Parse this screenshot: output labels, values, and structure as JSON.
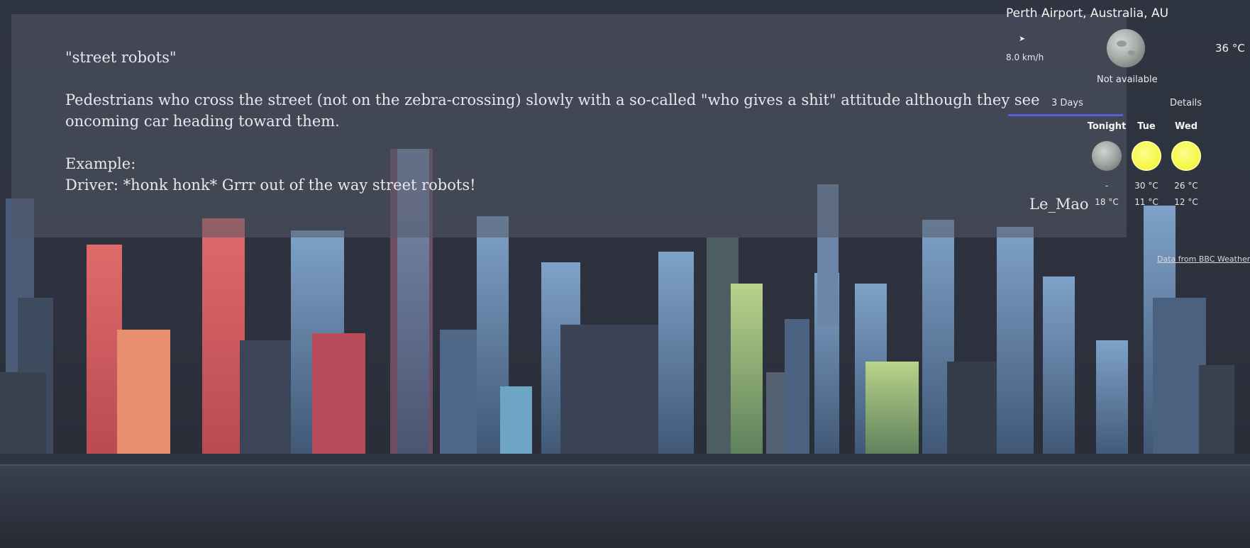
{
  "note": {
    "text": "\"street robots\"\n\nPedestrians who cross the street (not on the zebra-crossing) slowly with a so-called \"who gives a shit\" attitude although they see oncoming car heading toward them.\n\nExample:\nDriver: *honk honk* Grrr out of the way street robots!",
    "author": "Le_Mao"
  },
  "weather": {
    "location": "Perth Airport, Australia, AU",
    "wind_icon": "wind-arrow-icon",
    "wind_speed": "8.0 km/h",
    "current_icon": "night-moon-icon",
    "current_condition": "Not available",
    "current_temp": "36 °C",
    "tabs": [
      "3 Days",
      "Details"
    ],
    "accent": "#5a5fd8",
    "forecast": [
      {
        "day": "Tonight",
        "icon": "moon-icon",
        "high": "-",
        "low": "18 °C"
      },
      {
        "day": "Tue",
        "icon": "sun-icon",
        "high": "30 °C",
        "low": "11 °C"
      },
      {
        "day": "Wed",
        "icon": "sun-icon",
        "high": "26 °C",
        "low": "12 °C"
      }
    ],
    "credit": "Data from BBC Weather"
  }
}
